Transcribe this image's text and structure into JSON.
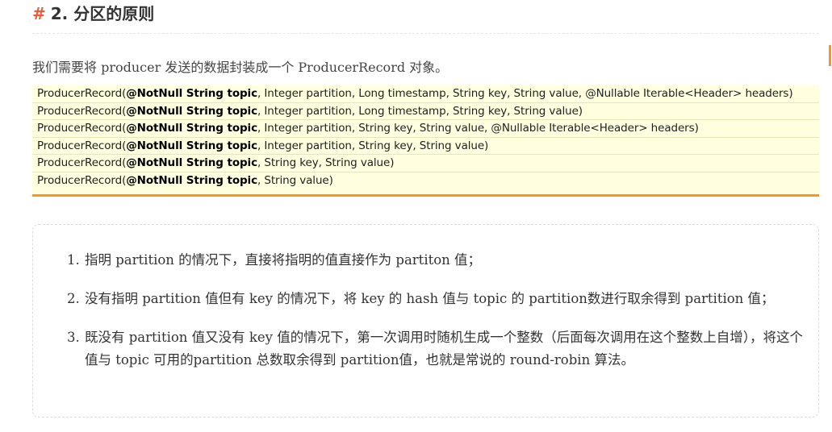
{
  "heading": {
    "hash": "#",
    "text": "2. 分区的原则"
  },
  "intro": "我们需要将 producer 发送的数据封装成一个 ProducerRecord 对象。",
  "code_rows": [
    {
      "prefix": "ProducerRecord(",
      "bold": "@NotNull String topic",
      "rest": ", Integer partition, Long timestamp, String key, String value, @Nullable Iterable<Header> headers)"
    },
    {
      "prefix": "ProducerRecord(",
      "bold": "@NotNull String topic",
      "rest": ", Integer partition, Long timestamp, String key, String value)"
    },
    {
      "prefix": "ProducerRecord(",
      "bold": "@NotNull String topic",
      "rest": ", Integer partition, String key, String value, @Nullable Iterable<Header> headers)"
    },
    {
      "prefix": "ProducerRecord(",
      "bold": "@NotNull String topic",
      "rest": ", Integer partition, String key, String value)"
    },
    {
      "prefix": "ProducerRecord(",
      "bold": "@NotNull String topic",
      "rest": ", String key, String value)"
    },
    {
      "prefix": "ProducerRecord(",
      "bold": "@NotNull String topic",
      "rest": ", String value)"
    }
  ],
  "rules": [
    {
      "num": "1.",
      "text": "指明 partition 的情况下，直接将指明的值直接作为 partiton 值；"
    },
    {
      "num": "2.",
      "text": "没有指明 partition 值但有 key 的情况下，将 key 的 hash 值与 topic 的 partition数进行取余得到 partition 值；"
    },
    {
      "num": "3.",
      "text": "既没有 partition 值又没有 key 值的情况下，第一次调用时随机生成一个整数（后面每次调用在这个整数上自增），将这个值与 topic 可用的partition 总数取余得到 partition值，也就是常说的 round-robin 算法。"
    }
  ],
  "colors": {
    "hash": "#ef5b3a",
    "code_bg": "#ffffe0",
    "code_border": "#f2991f"
  }
}
